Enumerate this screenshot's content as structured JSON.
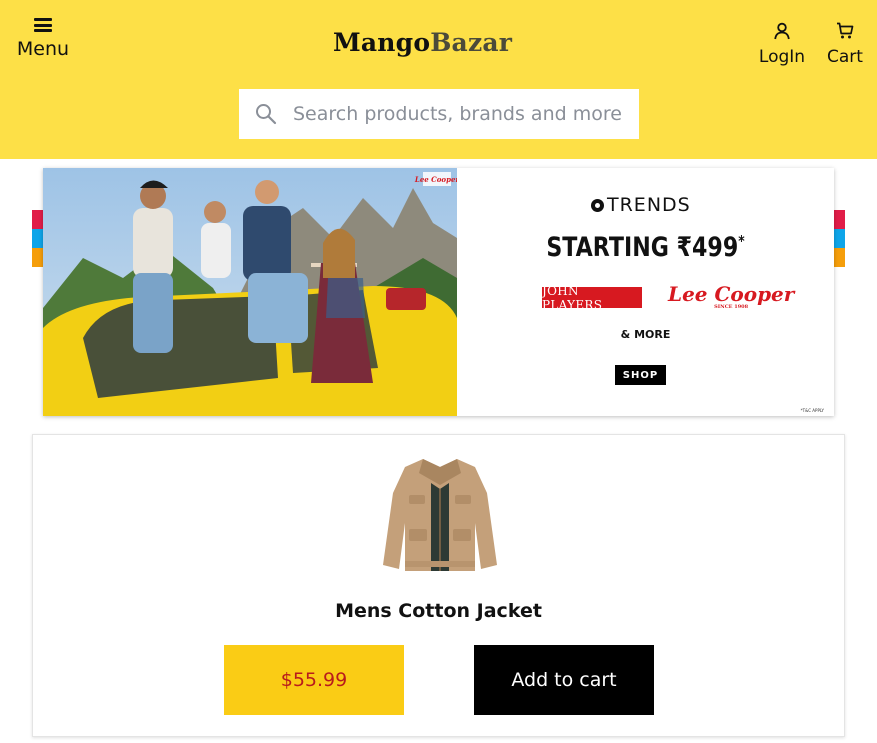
{
  "header": {
    "menu_label": "Menu",
    "logo_part1": "Mango",
    "logo_part2": "Bazar",
    "login_label": "LogIn",
    "cart_label": "Cart",
    "background_color": "#fde047"
  },
  "search": {
    "placeholder": "Search products, brands and more...",
    "value": "",
    "icon": "search-icon"
  },
  "banner": {
    "brand": "TRENDS",
    "headline": "STARTING ₹499",
    "headline_mark": "*",
    "logo_john_players": "JOHN PLAYERS",
    "logo_lee_cooper": "Lee Cooper",
    "logo_lee_cooper_sub": "SINCE 1908",
    "more_text": "& MORE",
    "shop_label": "SHOP",
    "tnc": "*T&C APPLY",
    "photo_badge": "Lee Cooper",
    "stripe_colors": [
      "#e11d48",
      "#0ea5e9",
      "#f59e0b"
    ]
  },
  "product": {
    "name": "Mens Cotton Jacket",
    "price": "$55.99",
    "add_to_cart_label": "Add to cart",
    "price_bg": "#facc15",
    "price_color": "#b91c1c"
  }
}
